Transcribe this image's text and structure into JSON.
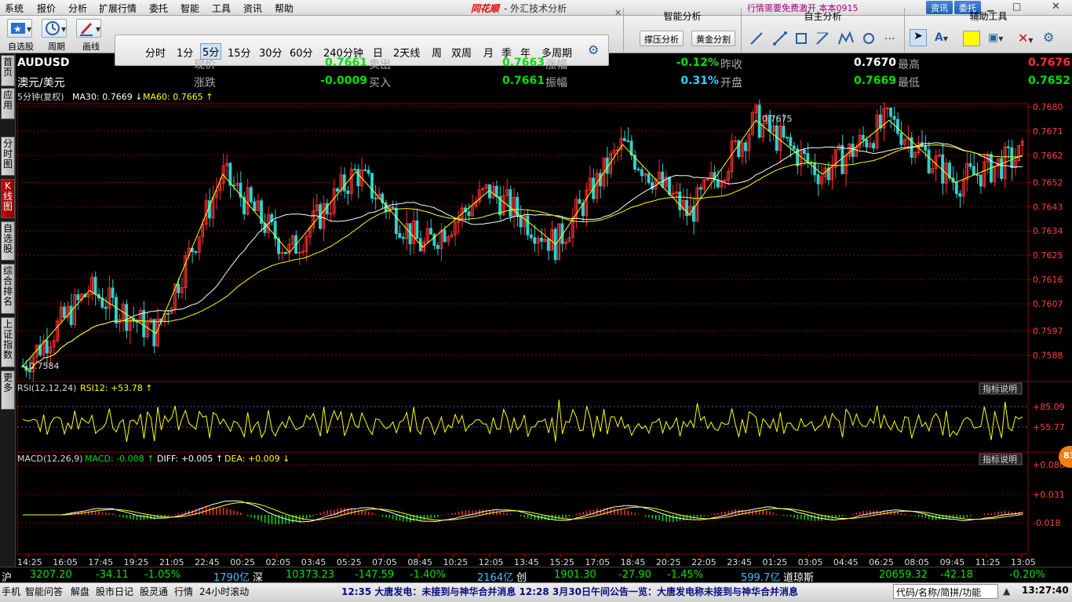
{
  "menu": {
    "items": [
      "系统",
      "报价",
      "分析",
      "扩展行情",
      "委托",
      "智能",
      "工具",
      "资讯",
      "帮助"
    ],
    "brand": "同花顺",
    "title": "- 外汇技术分析",
    "marquee": "行情需要免费激开   本本0915",
    "btn_zixun": "资讯",
    "btn_weituo": "委托"
  },
  "toolbar": {
    "groups": [
      {
        "label": "自选股"
      },
      {
        "label": "周期"
      },
      {
        "label": "画线"
      }
    ],
    "periods": [
      "分时",
      "1分",
      "5分",
      "15分",
      "30分",
      "60分",
      "240分钟",
      "日",
      "2天线",
      "周",
      "双周",
      "月",
      "季",
      "年",
      "多周期"
    ],
    "selected_period": "5分",
    "panels": {
      "smart": "智能分析",
      "smart_b1": "撑压分析",
      "smart_b2": "黄金分割",
      "self": "自主分析",
      "aux": "辅助工具"
    }
  },
  "leftnav": [
    "首页",
    "应用",
    "分时图",
    "K线图",
    "自选股",
    "综合排名",
    "上证指数",
    "更多"
  ],
  "quote": {
    "code": "AUDUSD",
    "name": "澳元/美元",
    "labels": {
      "xianjia": "现价",
      "zhangdie": "涨跌",
      "maichu": "卖出",
      "mairu": "买入",
      "zhangfu": "涨幅",
      "zhenfu": "振幅",
      "zuoshou": "昨收",
      "kaipan": "开盘",
      "zuigao": "最高",
      "zuidi": "最低"
    },
    "values": {
      "xianjia": "0.7661",
      "zhangdie": "-0.0009",
      "maichu": "0.7663",
      "mairu": "0.7661",
      "zhangfu": "-0.12%",
      "zhenfu": "0.31%",
      "zuoshou": "0.7670",
      "kaipan": "0.7669",
      "zuigao": "0.7676",
      "zuidi": "0.7652"
    }
  },
  "colors": {
    "up": "#ff3030",
    "down": "#30d0d0",
    "green": "#00e000",
    "yellow": "#ffff00",
    "white": "#ffffff",
    "grid": "#8a0000"
  },
  "chart_data": [
    {
      "type": "candlestick",
      "title": "5分钟(复权)",
      "legend": [
        "MA30: 0.7669",
        "MA60: 0.7665"
      ],
      "ylim": [
        0.758,
        0.768
      ],
      "yticks": [
        "0.7680",
        "0.7671",
        "0.7662",
        "0.7652",
        "0.7643",
        "0.7634",
        "0.7625",
        "0.7616",
        "0.7607",
        "0.7597",
        "0.7588"
      ],
      "xticks": [
        "14:25",
        "16:05",
        "17:45",
        "19:25",
        "21:05",
        "22:45",
        "00:25",
        "02:05",
        "03:45",
        "05:25",
        "07:05",
        "08:45",
        "10:25",
        "12:05",
        "13:45",
        "15:25",
        "17:05",
        "18:45",
        "20:25",
        "22:05",
        "23:45",
        "01:25",
        "03:05",
        "04:45",
        "06:25",
        "08:05",
        "09:45",
        "11:25",
        "13:05"
      ],
      "annotations": [
        "0.7675",
        "0.7584"
      ],
      "zigzag": [
        0.7584,
        0.7612,
        0.7596,
        0.7655,
        0.7626,
        0.7656,
        0.7628,
        0.7649,
        0.7629,
        0.7666,
        0.764,
        0.7675,
        0.7655,
        0.7675,
        0.7652,
        0.7662
      ]
    },
    {
      "type": "line",
      "title": "RSI(12,12,24)",
      "legend": [
        "RSI12: +53.78"
      ],
      "yticks": [
        "+85.09",
        "+55.77"
      ],
      "button": "指标说明"
    },
    {
      "type": "bar",
      "title": "MACD(12,26,9)",
      "legend": [
        "MACD: -0.008",
        "DIFF: +0.005",
        "DEA: +0.009"
      ],
      "yticks": [
        "+0.080",
        "+0.031",
        "-0.018"
      ],
      "button": "指标说明"
    }
  ],
  "bottom": [
    {
      "label": "沪",
      "v1": "3207.20",
      "v2": "-34.11",
      "v3": "-1.05%",
      "v4": "1790亿"
    },
    {
      "label": "深",
      "v1": "10373.23",
      "v2": "-147.59",
      "v3": "-1.40%",
      "v4": "2164亿"
    },
    {
      "label": "创",
      "v1": "1901.30",
      "v2": "-27.90",
      "v3": "-1.45%",
      "v4": "599.7亿"
    },
    {
      "label": "道琼斯",
      "v1": "20659.32",
      "v2": "-42.18",
      "v3": "-0.20%"
    }
  ],
  "status": {
    "items": [
      "手机",
      "智能问答",
      "解盘",
      "股市日记",
      "股灵通",
      "行情",
      "24小时滚动"
    ],
    "ticker": "12:35 大唐发电：未接到与神华合并消息        12:28 3月30日午间公告一览：大唐发电称未接到与神华合并消息",
    "code_placeholder": "代码/名称/简拼/功能",
    "time": "13:27:40"
  },
  "badge": "83"
}
